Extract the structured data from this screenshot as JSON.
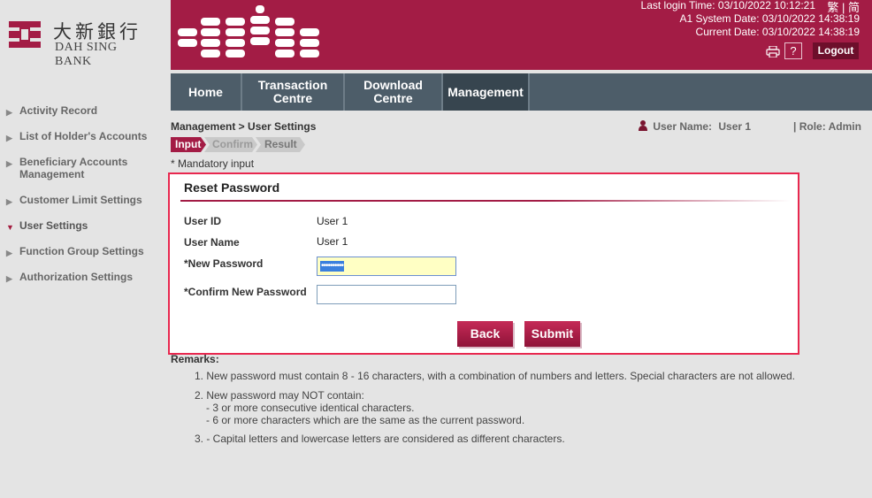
{
  "logo": {
    "cn": "大新銀行",
    "en": "DAH SING BANK"
  },
  "sidebar": {
    "items": [
      {
        "label": "Activity Record",
        "active": false
      },
      {
        "label": "List of Holder's Accounts",
        "active": false
      },
      {
        "label": "Beneficiary Accounts Management",
        "active": false
      },
      {
        "label": "Customer Limit Settings",
        "active": false
      },
      {
        "label": "User Settings",
        "active": true
      },
      {
        "label": "Function Group Settings",
        "active": false
      },
      {
        "label": "Authorization Settings",
        "active": false
      }
    ]
  },
  "header": {
    "last_login": "Last login Time: 03/10/2022 10:12:21",
    "system_date": "A1 System Date: 03/10/2022 14:38:19",
    "current_date": "Current Date: 03/10/2022 14:38:19",
    "lang_trad": "繁",
    "lang_simp": "简",
    "lang_sep": "|",
    "help_label": "?",
    "logout_label": "Logout",
    "brand_color": "#a31c45"
  },
  "nav": {
    "tabs": [
      {
        "label": "Home",
        "active": false
      },
      {
        "label": "Transaction Centre",
        "active": false
      },
      {
        "label": "Download Centre",
        "active": false
      },
      {
        "label": "Management",
        "active": true
      }
    ]
  },
  "breadcrumb": "Management > User Settings",
  "user": {
    "name_label": "User Name:",
    "name": "User 1",
    "role": "| Role: Admin"
  },
  "steps": [
    "Input",
    "Confirm",
    "Result"
  ],
  "mandatory": "* Mandatory input",
  "form": {
    "title": "Reset Password",
    "user_id_label": "User ID",
    "user_id": "User 1",
    "user_name_label": "User Name",
    "user_name": "User 1",
    "new_password_label": "*New Password",
    "new_password_value": "••••••••••",
    "confirm_password_label": "*Confirm New Password",
    "confirm_password_value": "",
    "back_label": "Back",
    "submit_label": "Submit"
  },
  "remarks": {
    "title": "Remarks:",
    "items": [
      "1. New password must contain 8 - 16 characters, with a combination of numbers and letters. Special characters are not allowed.",
      "2. New password may NOT contain:",
      "- 3 or more consecutive identical characters.",
      "- 6 or more characters which are the same as the current password.",
      "3. - Capital letters and lowercase letters are considered as different characters."
    ]
  }
}
